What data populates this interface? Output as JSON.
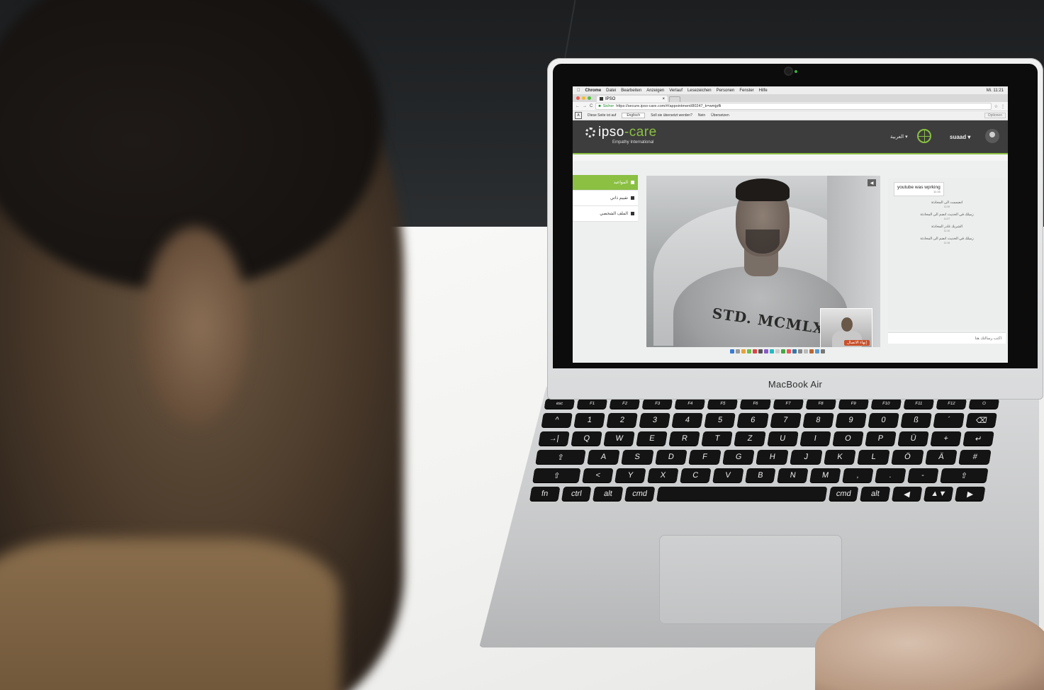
{
  "menubar": {
    "items": [
      "Chrome",
      "Datei",
      "Bearbeiten",
      "Anzeigen",
      "Verlauf",
      "Lesezeichen",
      "Personen",
      "Fenster",
      "Hilfe"
    ],
    "clock": "Mi. 11:21"
  },
  "browser": {
    "tab_title": "IPSO",
    "secure_label": "Sicher",
    "url": "https://secure.ipso-care.com/#/appointment/80247_k=wmjpfli",
    "translate": {
      "lead": "Diese Seite ist auf",
      "language": "Englisch",
      "question": "Soll sie übersetzt werden?",
      "no": "Nein",
      "translate": "Übersetzen",
      "options": "Optionen"
    }
  },
  "site": {
    "logo_i": "i",
    "logo_pso": "pso",
    "logo_dash": "-",
    "logo_care": "care",
    "tagline": "Empathy International",
    "language_menu": "العربية ▾",
    "user_menu": "suaad ▾"
  },
  "sidenav": {
    "items": [
      {
        "label": "المواعيد",
        "active": true
      },
      {
        "label": "تقييم ذاتي",
        "active": false
      },
      {
        "label": "الملف الشخصي",
        "active": false
      }
    ]
  },
  "video": {
    "shirt_print": "STD. MCMLXXXI",
    "end_call_label": "إنهاء الاتصال"
  },
  "chat": {
    "message": {
      "text": "youtube was wprking",
      "time": "11:16"
    },
    "events": [
      {
        "text": "انضممت الى المحادثة",
        "time": "11:09"
      },
      {
        "text": "زميلك في الحديث انضم الى المحادثة",
        "time": "11:07"
      },
      {
        "text": "الشريك غادر المحادثة",
        "time": "11:10"
      },
      {
        "text": "زميلك في الحديث انضم الى المحادثة",
        "time": "11:16"
      }
    ],
    "input_placeholder": "اكتب رسالتك هنا"
  },
  "laptop": {
    "brand": "MacBook Air"
  },
  "keyboard": {
    "rows": [
      [
        "esc",
        "F1",
        "F2",
        "F3",
        "F4",
        "F5",
        "F6",
        "F7",
        "F8",
        "F9",
        "F10",
        "F11",
        "F12",
        "⏻"
      ],
      [
        "^",
        "1",
        "2",
        "3",
        "4",
        "5",
        "6",
        "7",
        "8",
        "9",
        "0",
        "ß",
        "´",
        "⌫"
      ],
      [
        "→|",
        "Q",
        "W",
        "E",
        "R",
        "T",
        "Z",
        "U",
        "I",
        "O",
        "P",
        "Ü",
        "+",
        "↵"
      ],
      [
        "⇪",
        "A",
        "S",
        "D",
        "F",
        "G",
        "H",
        "J",
        "K",
        "L",
        "Ö",
        "Ä",
        "#"
      ],
      [
        "⇧",
        "<",
        "Y",
        "X",
        "C",
        "V",
        "B",
        "N",
        "M",
        ",",
        ".",
        "-",
        "⇧"
      ],
      [
        "fn",
        "ctrl",
        "alt",
        "cmd",
        "",
        "cmd",
        "alt",
        "◀",
        "▲▼",
        "▶"
      ]
    ]
  },
  "colors": {
    "brand_green": "#8bc043",
    "header_dark": "#3d3d3d",
    "end_call": "#c9502a"
  }
}
